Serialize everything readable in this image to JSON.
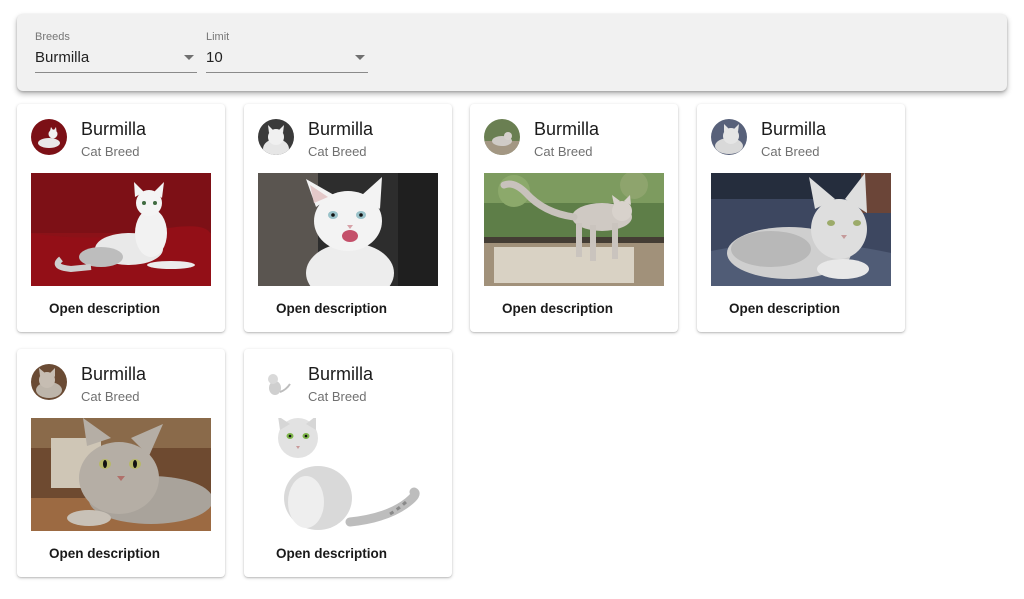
{
  "filters": {
    "breeds": {
      "label": "Breeds",
      "value": "Burmilla"
    },
    "limit": {
      "label": "Limit",
      "value": "10"
    }
  },
  "cards": [
    {
      "title": "Burmilla",
      "subtitle": "Cat Breed",
      "action": "Open description",
      "photo": "cat-on-red-blanket"
    },
    {
      "title": "Burmilla",
      "subtitle": "Cat Breed",
      "action": "Open description",
      "photo": "white-cat-tongue-out"
    },
    {
      "title": "Burmilla",
      "subtitle": "Cat Breed",
      "action": "Open description",
      "photo": "cat-on-porch"
    },
    {
      "title": "Burmilla",
      "subtitle": "Cat Breed",
      "action": "Open description",
      "photo": "cat-lying-on-blanket"
    },
    {
      "title": "Burmilla",
      "subtitle": "Cat Breed",
      "action": "Open description",
      "photo": "tabby-cat-lying"
    },
    {
      "title": "Burmilla",
      "subtitle": "Cat Breed",
      "action": "Open description",
      "photo": "sitting-cat-white-background"
    }
  ],
  "colors": {
    "toolbar_bg": "#f1f1f1",
    "card_bg": "#ffffff",
    "subtitle": "#707070"
  }
}
